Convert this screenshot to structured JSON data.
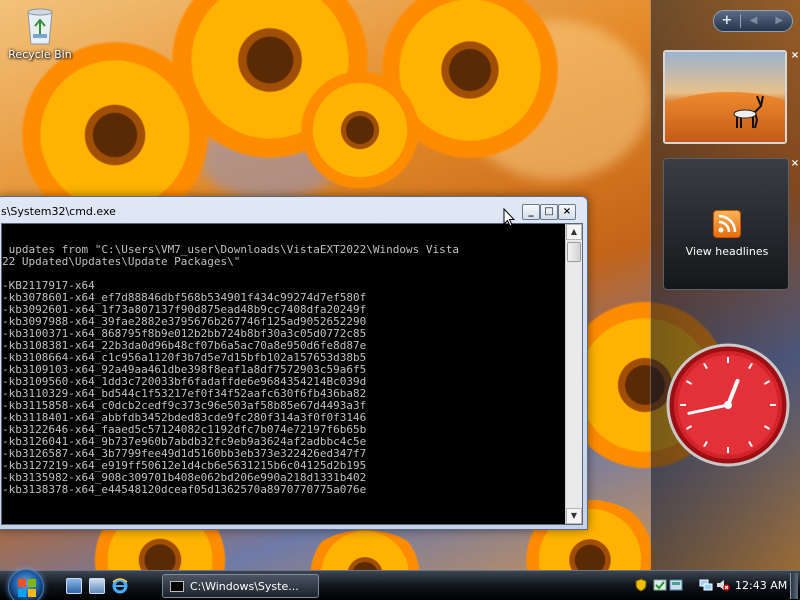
{
  "desktop": {
    "icons": [
      {
        "label": "Recycle Bin",
        "icon": "recycle-bin-icon"
      }
    ]
  },
  "sidebar": {
    "controls": {
      "add": "+",
      "prev": "◀",
      "next": "▶"
    },
    "close_glyph": "×",
    "feed": {
      "label": "View headlines",
      "icon": "rss-icon"
    },
    "clock": {
      "hour": 12,
      "minute": 43
    }
  },
  "console": {
    "title": "s\\System32\\cmd.exe",
    "buttons": {
      "minimize": "_",
      "maximize": "□",
      "close": "×"
    },
    "lines": [
      "",
      " updates from \"C:\\Users\\VM7_user\\Downloads\\VistaEXT2022\\Windows Vista",
      "22 Updated\\Updates\\Update Packages\\\"",
      "",
      "-KB2117917-x64",
      "-kb3078601-x64_ef7d88846dbf568b534901f434c99274d7ef580f",
      "-kb3092601-x64_1f73a807137f90d875ead48b9cc7408dfa20249f",
      "-kb3097988-x64_39fae2882e3795676b267746f125ad9052652290",
      "-kb3100371-x64_868795f8b9e012b2bb724b8bf30a3c05d0772c85",
      "-kb3108381-x64_22b3da0d96b48cf07b6a5ac70a8e950d6fe8d87e",
      "-kb3108664-x64_c1c956a1120f3b7d5e7d15bfb102a157653d38b5",
      "-kb3109103-x64_92a49aa461dbe398f8eaf1a8df7572903c59a6f5",
      "-kb3109560-x64_1dd3c720033bf6fadaffde6e9684354214Bc039d",
      "-kb3110329-x64_bd544c1f53217ef0f34f52aafc630f6fb436ba82",
      "-kb3115858-x64_c0dcb2cedf9c373c96e503af58b85e67d4493a3f",
      "-kb3118401-x64_abbfdb3452bded83cde9fc280f314a3f0f0f3146",
      "-kb3122646-x64_faaed5c57124082c1192dfc7b074e72197f6b65b",
      "-kb3126041-x64_9b737e960b7abdb32fc9eb9a3624af2adbbc4c5e",
      "-kb3126587-x64_3b7799fee49d1d5160bb3eb373e322426ed347f7",
      "-kb3127219-x64_e919ff50612e1d4cb6e5631215b6c04125d2b195",
      "-kb3135982-x64_908c309701b408e062bd206e990a218d1331b402",
      "-kb3138378-x64_e44548120dceaf05d1362570a8970770775a076e"
    ]
  },
  "taskbar": {
    "task_label": "C:\\Windows\\Syste...",
    "time": "12:43 AM",
    "quick_launch": [
      "show-desktop-icon",
      "switch-windows-icon",
      "internet-explorer-icon"
    ],
    "tray_icons": [
      "security-shield-icon",
      "update-icon",
      "network-icon",
      "volume-muted-icon"
    ]
  }
}
